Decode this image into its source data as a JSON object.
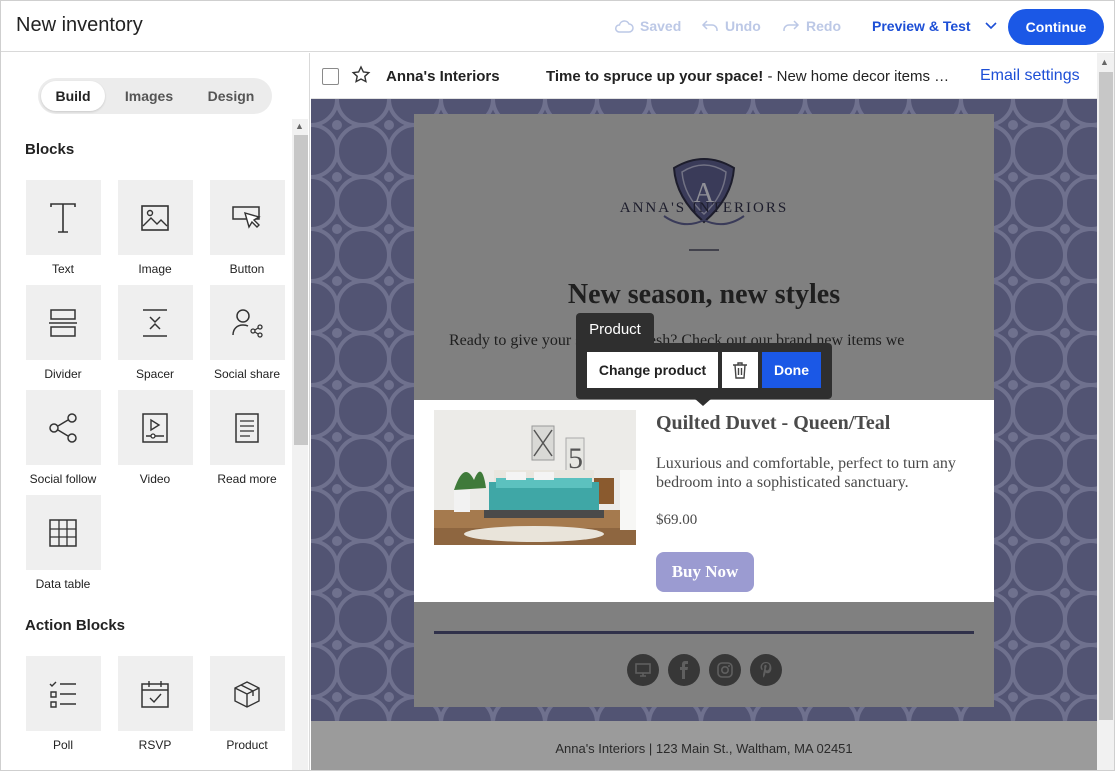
{
  "app": {
    "title": "New inventory",
    "saved_label": "Saved",
    "undo_label": "Undo",
    "redo_label": "Redo",
    "preview_label": "Preview & Test",
    "continue_label": "Continue"
  },
  "sidebar": {
    "tabs": [
      {
        "label": "Build",
        "active": true
      },
      {
        "label": "Images",
        "active": false
      },
      {
        "label": "Design",
        "active": false
      }
    ],
    "blocks_title": "Blocks",
    "blocks": [
      {
        "label": "Text",
        "icon": "text-icon"
      },
      {
        "label": "Image",
        "icon": "image-icon"
      },
      {
        "label": "Button",
        "icon": "button-icon"
      },
      {
        "label": "Divider",
        "icon": "divider-icon"
      },
      {
        "label": "Spacer",
        "icon": "spacer-icon"
      },
      {
        "label": "Social share",
        "icon": "social-share-icon"
      },
      {
        "label": "Social follow",
        "icon": "social-follow-icon"
      },
      {
        "label": "Video",
        "icon": "video-icon"
      },
      {
        "label": "Read more",
        "icon": "read-more-icon"
      },
      {
        "label": "Data table",
        "icon": "data-table-icon"
      }
    ],
    "action_blocks_title": "Action Blocks",
    "action_blocks": [
      {
        "label": "Poll",
        "icon": "poll-icon"
      },
      {
        "label": "RSVP",
        "icon": "rsvp-icon"
      },
      {
        "label": "Product",
        "icon": "product-icon"
      }
    ]
  },
  "email_header": {
    "sender": "Anna's Interiors",
    "subject_bold": "Time to spruce up your space!",
    "subject_rest": " - New home decor items …",
    "settings_link": "Email settings"
  },
  "email": {
    "logo_letter": "A",
    "logo_text": "ANNA'S INTERIORS",
    "headline": "New season, new styles",
    "intro": "Ready to give your space a refresh? Check out our brand new items we",
    "product": {
      "title": "Quilted Duvet - Queen/Teal",
      "description": "Luxurious and comfortable, perfect to turn any bedroom into a sophisticated sanctuary.",
      "price": "$69.00",
      "button": "Buy Now"
    },
    "footer": "Anna's Interiors | 123 Main St., Waltham, MA 02451"
  },
  "popup": {
    "label": "Product",
    "change_label": "Change product",
    "done_label": "Done"
  },
  "colors": {
    "accent": "#1b58e6",
    "canvas_pattern": "#6a6c94",
    "buy_button": "#9b9bd1"
  }
}
